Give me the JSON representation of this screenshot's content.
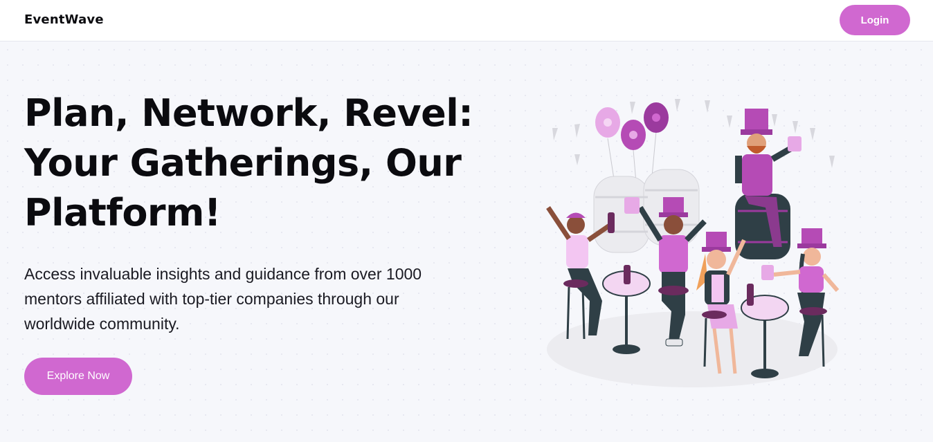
{
  "header": {
    "brand": "EventWave",
    "login_label": "Login"
  },
  "hero": {
    "headline_line1": "Plan, Network, Revel:",
    "headline_line2": "Your Gatherings, Our",
    "headline_line3": "Platform!",
    "subtext_line1": "Access invaluable insights and guidance from over 1000",
    "subtext_line2": "mentors affiliated with top-tier companies through our",
    "subtext_line3": "worldwide community.",
    "cta_label": "Explore Now",
    "illustration": "party-celebration-illustration"
  },
  "colors": {
    "accent": "#d068d0",
    "background": "#f6f7fb",
    "header_bg": "#ffffff",
    "text": "#0b0b0f"
  }
}
